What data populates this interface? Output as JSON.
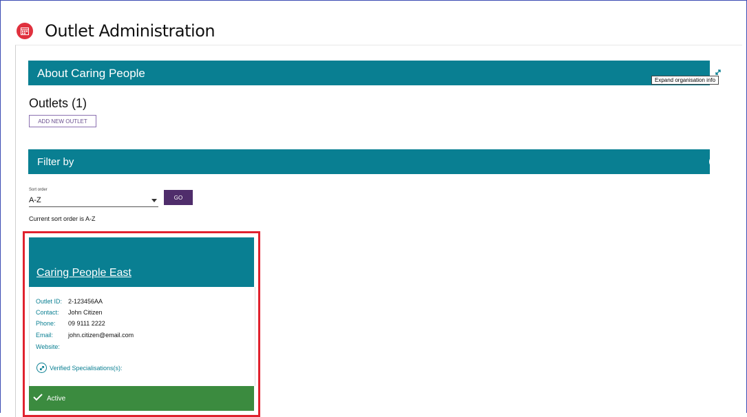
{
  "app": {
    "title": "Outlet Administration",
    "icon": "calendar-icon",
    "accent": "#e0313e"
  },
  "about": {
    "title": "About Caring People",
    "tooltip": "Expand organisation info",
    "icon": "expand-icon"
  },
  "outlets": {
    "title": "Outlets (1)",
    "add_button": "ADD NEW OUTLET"
  },
  "filter": {
    "title": "Filter by",
    "icon": "expand-icon"
  },
  "sort": {
    "label": "Sort order",
    "value": "A-Z",
    "go_button": "GO",
    "current_text": "Current sort order is A-Z"
  },
  "outlet_card": {
    "name": "Caring People East",
    "fields": [
      {
        "key": "Outlet ID:",
        "value": "2-123456AA"
      },
      {
        "key": "Contact:",
        "value": "John Citizen"
      },
      {
        "key": "Phone:",
        "value": "09 9111 2222"
      },
      {
        "key": "Email:",
        "value": "john.citizen@email.com"
      },
      {
        "key": "Website:",
        "value": ""
      }
    ],
    "verified_label": "Verified Specialisations(s):",
    "status": "Active"
  },
  "colors": {
    "teal": "#097f92",
    "purple": "#4f2d6b",
    "green": "#3b8b3f",
    "highlight": "#e0212e"
  }
}
